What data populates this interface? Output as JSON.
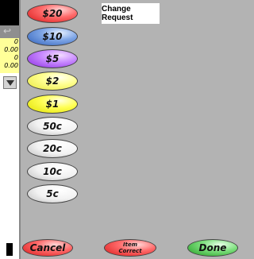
{
  "left_panel": {
    "arrow_glyph": "↩",
    "values": [
      "0",
      "0.00",
      "0",
      "0.00"
    ]
  },
  "title": "Change Request",
  "denominations": [
    {
      "label": "$20",
      "color": "#ff6b6b"
    },
    {
      "label": "$10",
      "color": "#7fa6e6"
    },
    {
      "label": "$5",
      "color": "#c98bff"
    },
    {
      "label": "$2",
      "color": "#ffff90"
    },
    {
      "label": "$1",
      "color": "#ffff55"
    },
    {
      "label": "50c",
      "color": "#f2f2f2"
    },
    {
      "label": "20c",
      "color": "#f2f2f2"
    },
    {
      "label": "10c",
      "color": "#f2f2f2"
    },
    {
      "label": "5c",
      "color": "#f2f2f2"
    }
  ],
  "footer": {
    "cancel_label": "Cancel",
    "item_correct_line1": "Item",
    "item_correct_line2": "Correct",
    "done_label": "Done"
  }
}
